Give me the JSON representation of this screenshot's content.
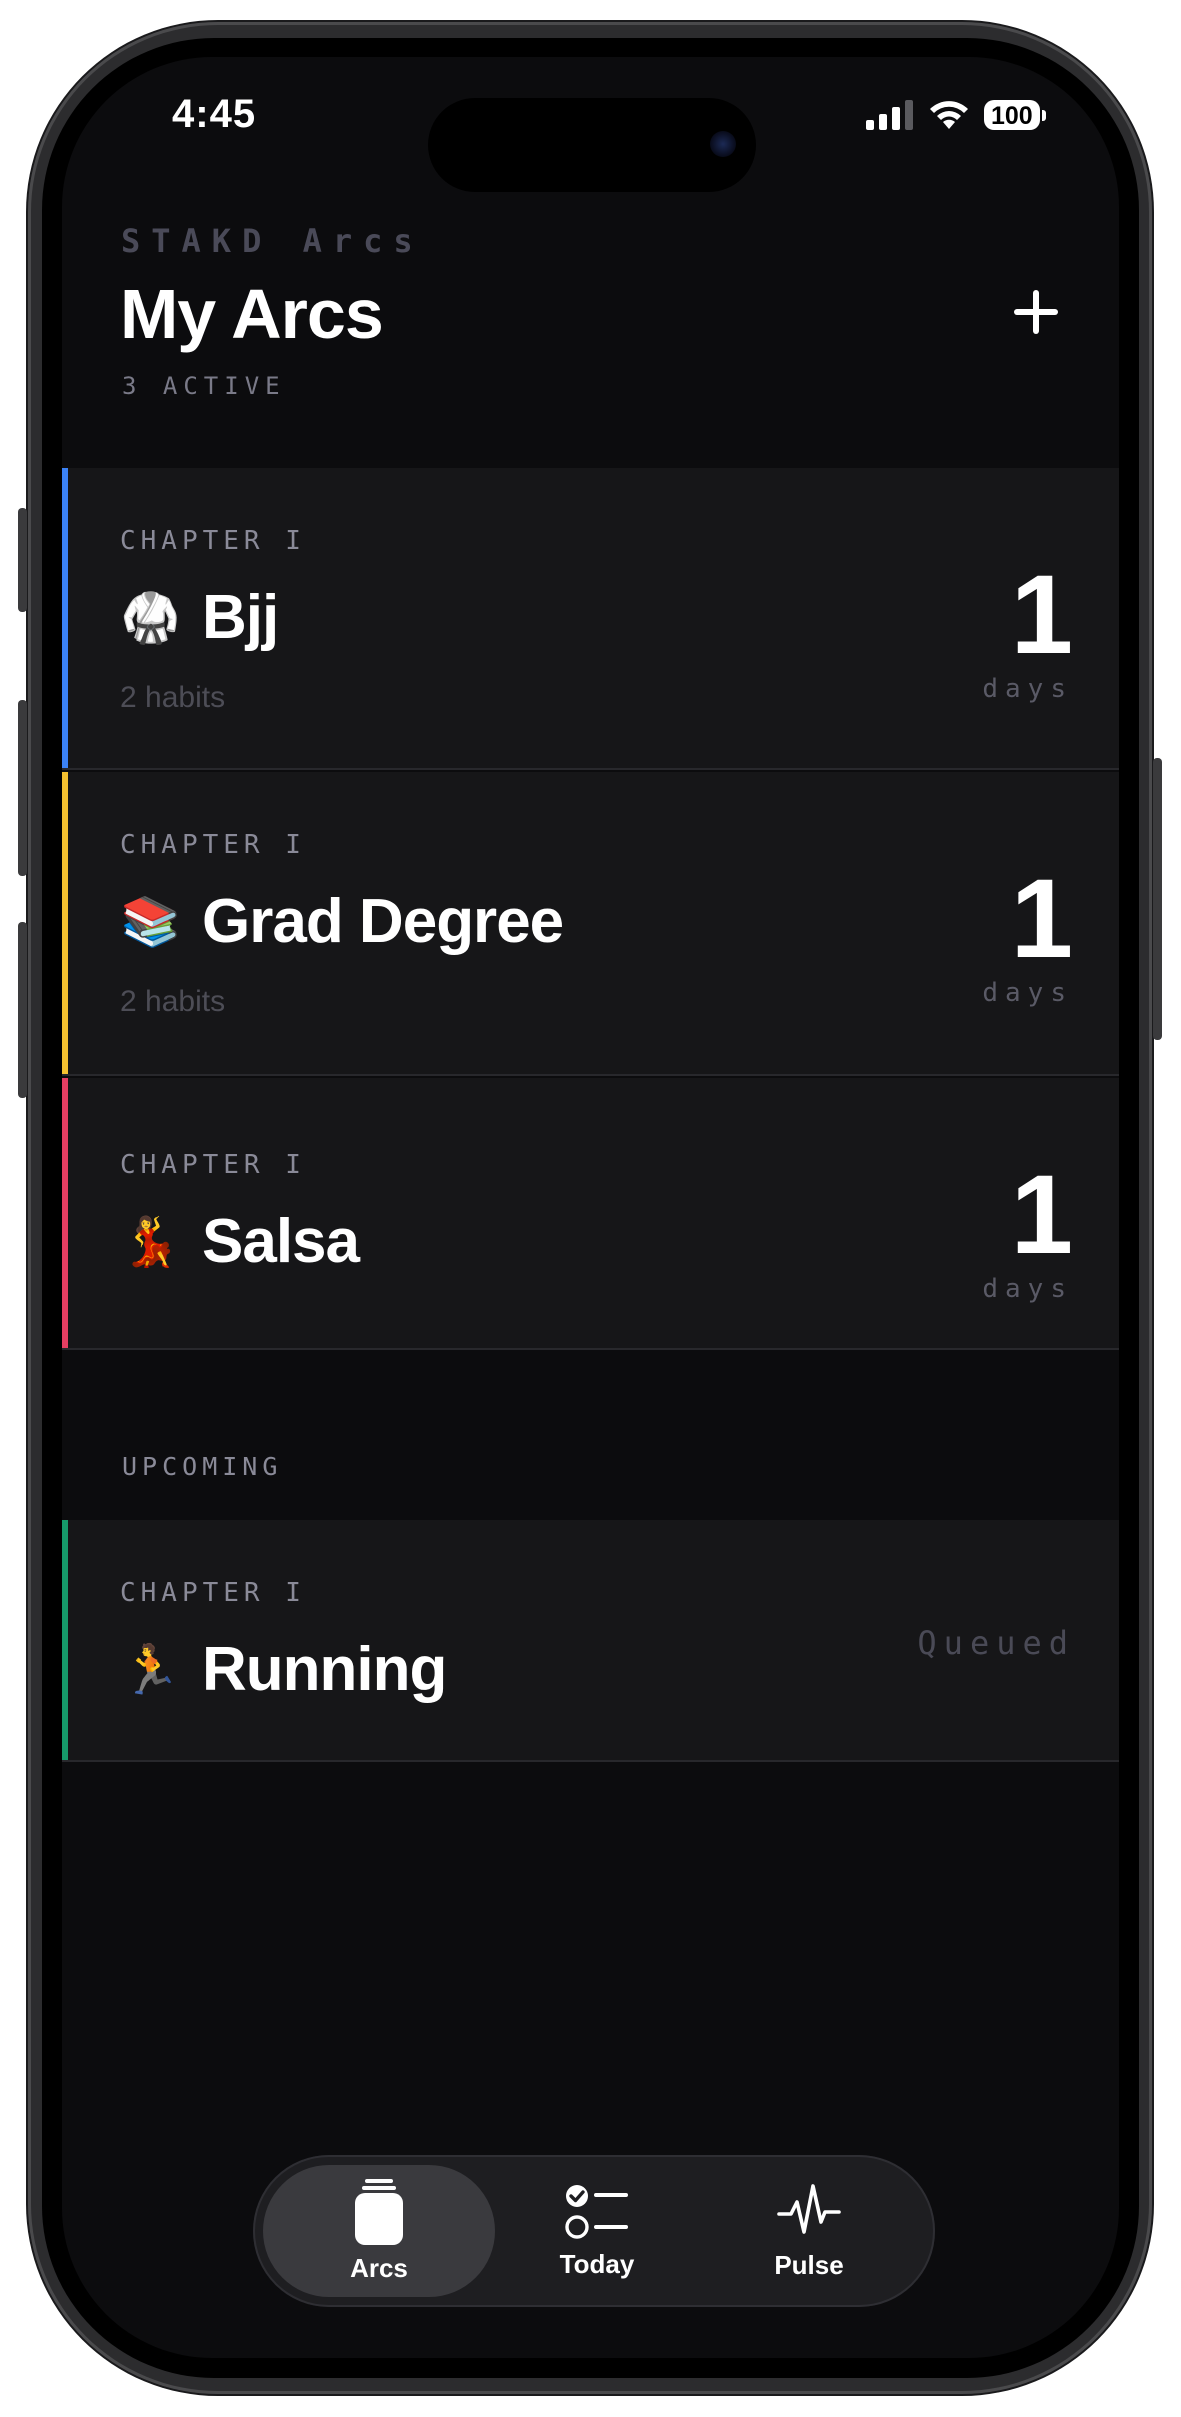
{
  "status_bar": {
    "time": "4:45",
    "battery": "100"
  },
  "header": {
    "brand": "STAKD Arcs",
    "title": "My Arcs",
    "active_count": "3 ACTIVE"
  },
  "arcs": [
    {
      "chapter": "CHAPTER I",
      "emoji": "🥋",
      "name": "Bjj",
      "habits": "2 habits",
      "streak": "1",
      "streak_unit": "days",
      "accent": "#3b82f6"
    },
    {
      "chapter": "CHAPTER I",
      "emoji": "📚",
      "name": "Grad Degree",
      "habits": "2 habits",
      "streak": "1",
      "streak_unit": "days",
      "accent": "#f5c130"
    },
    {
      "chapter": "CHAPTER I",
      "emoji": "💃",
      "name": "Salsa",
      "streak": "1",
      "streak_unit": "days",
      "accent": "#e63e62"
    }
  ],
  "upcoming": {
    "label": "UPCOMING",
    "items": [
      {
        "chapter": "CHAPTER I",
        "emoji": "🏃",
        "name": "Running",
        "status": "Queued",
        "accent": "#169a6a"
      }
    ]
  },
  "tabs": [
    {
      "label": "Arcs",
      "icon": "jar-icon",
      "active": true
    },
    {
      "label": "Today",
      "icon": "checklist-icon",
      "active": false
    },
    {
      "label": "Pulse",
      "icon": "pulse-icon",
      "active": false
    }
  ]
}
